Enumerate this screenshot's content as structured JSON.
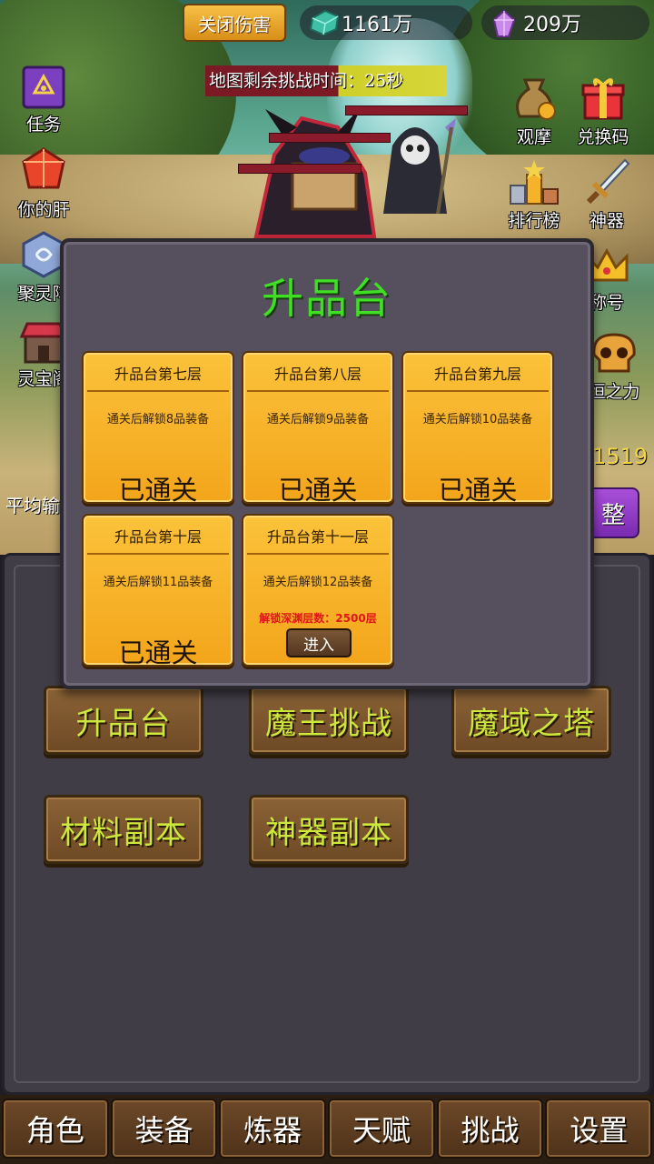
{
  "top_bar": {
    "close_damage_label": "关闭伤害",
    "jade_amount": "1161万",
    "crystal_amount": "209万"
  },
  "battle": {
    "map_timer_text": "地图剩余挑战时间：25秒"
  },
  "left_icons": [
    {
      "label": "任务",
      "icon": "quest-book-icon"
    },
    {
      "label": "你的肝",
      "icon": "red-gem-icon"
    },
    {
      "label": "聚灵阵",
      "icon": "spirit-stone-icon"
    },
    {
      "label": "灵宝阁",
      "icon": "shop-icon"
    }
  ],
  "right_icons": [
    {
      "label": "观摩",
      "icon": "money-bag-icon"
    },
    {
      "label": "兑换码",
      "icon": "gift-box-icon"
    },
    {
      "label": "排行榜",
      "icon": "trophy-podium-icon"
    },
    {
      "label": "神器",
      "icon": "sword-icon"
    },
    {
      "label": "称号",
      "icon": "crown-icon"
    },
    {
      "label": "恒之力",
      "icon": "skull-icon"
    }
  ],
  "stats": {
    "avg_dps_label": "平均输",
    "power_value": "1519",
    "purple_button_label": "整"
  },
  "menu": {
    "upgrade_altar": "升品台",
    "demon_king": "魔王挑战",
    "demon_tower": "魔域之塔",
    "material_dungeon": "材料副本",
    "artifact_dungeon": "神器副本"
  },
  "nav": [
    "角色",
    "装备",
    "炼器",
    "天赋",
    "挑战",
    "设置"
  ],
  "modal": {
    "title": "升品台",
    "cards": [
      {
        "title": "升品台第七层",
        "desc": "通关后解锁8品装备",
        "status": "已通关"
      },
      {
        "title": "升品台第八层",
        "desc": "通关后解锁9品装备",
        "status": "已通关"
      },
      {
        "title": "升品台第九层",
        "desc": "通关后解锁10品装备",
        "status": "已通关"
      },
      {
        "title": "升品台第十层",
        "desc": "通关后解锁11品装备",
        "status": "已通关"
      },
      {
        "title": "升品台第十一层",
        "desc": "通关后解锁12品装备",
        "requirement": "解锁深渊层数：2500层",
        "enter_label": "进入"
      }
    ]
  },
  "colors": {
    "modal_title": "#3fe024",
    "menu_text": "#cde83d",
    "card_bg": "#f3a51b",
    "requirement_text": "#e0161b",
    "power_value": "#f3d54a"
  }
}
